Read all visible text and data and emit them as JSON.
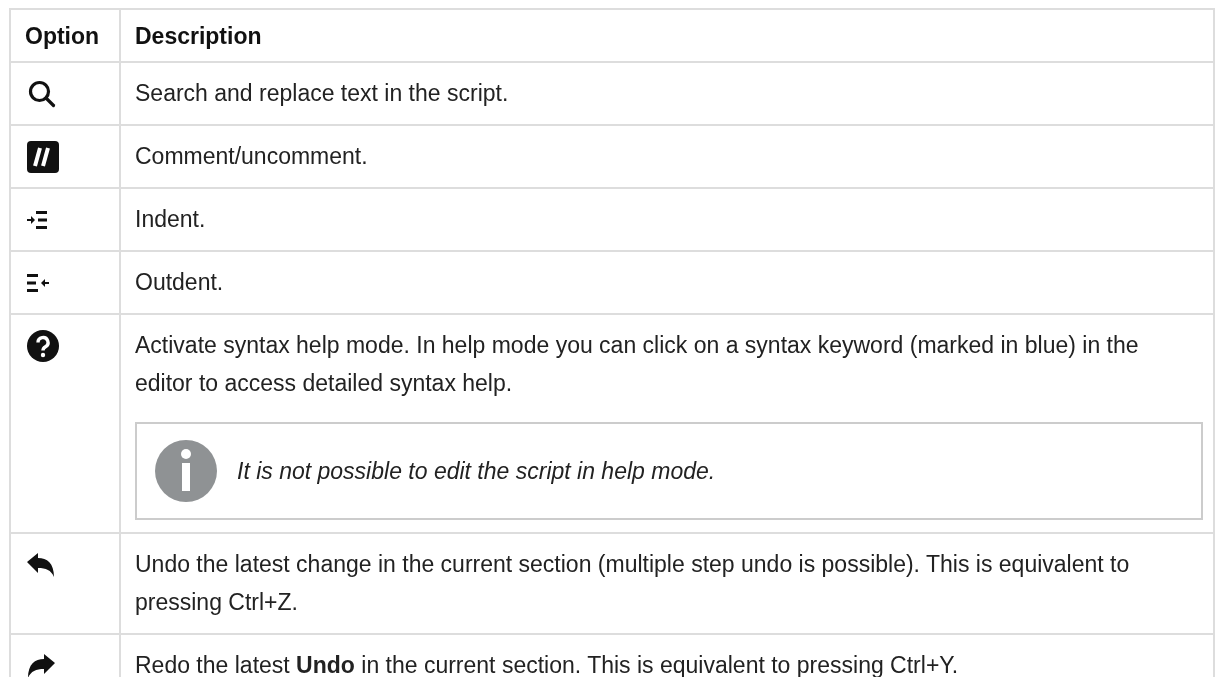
{
  "table": {
    "columns": [
      "Option",
      "Description"
    ],
    "rows": [
      {
        "kind": "search",
        "description": "Search and replace text in the script."
      },
      {
        "kind": "comment",
        "description": "Comment/uncomment."
      },
      {
        "kind": "indent",
        "description": "Indent."
      },
      {
        "kind": "outdent",
        "description": "Outdent."
      },
      {
        "kind": "help",
        "description": "Activate syntax help mode. In help mode you can click on a syntax keyword (marked in blue) in the editor to access detailed syntax help.",
        "note": "It is not possible to edit the script in help mode."
      },
      {
        "kind": "undo",
        "description": "Undo the latest change in the current section (multiple step undo is possible). This is equivalent to pressing Ctrl+Z."
      },
      {
        "kind": "redo",
        "description": "Redo the latest **Undo** in the current section. This is equivalent to pressing Ctrl+Y."
      }
    ]
  }
}
